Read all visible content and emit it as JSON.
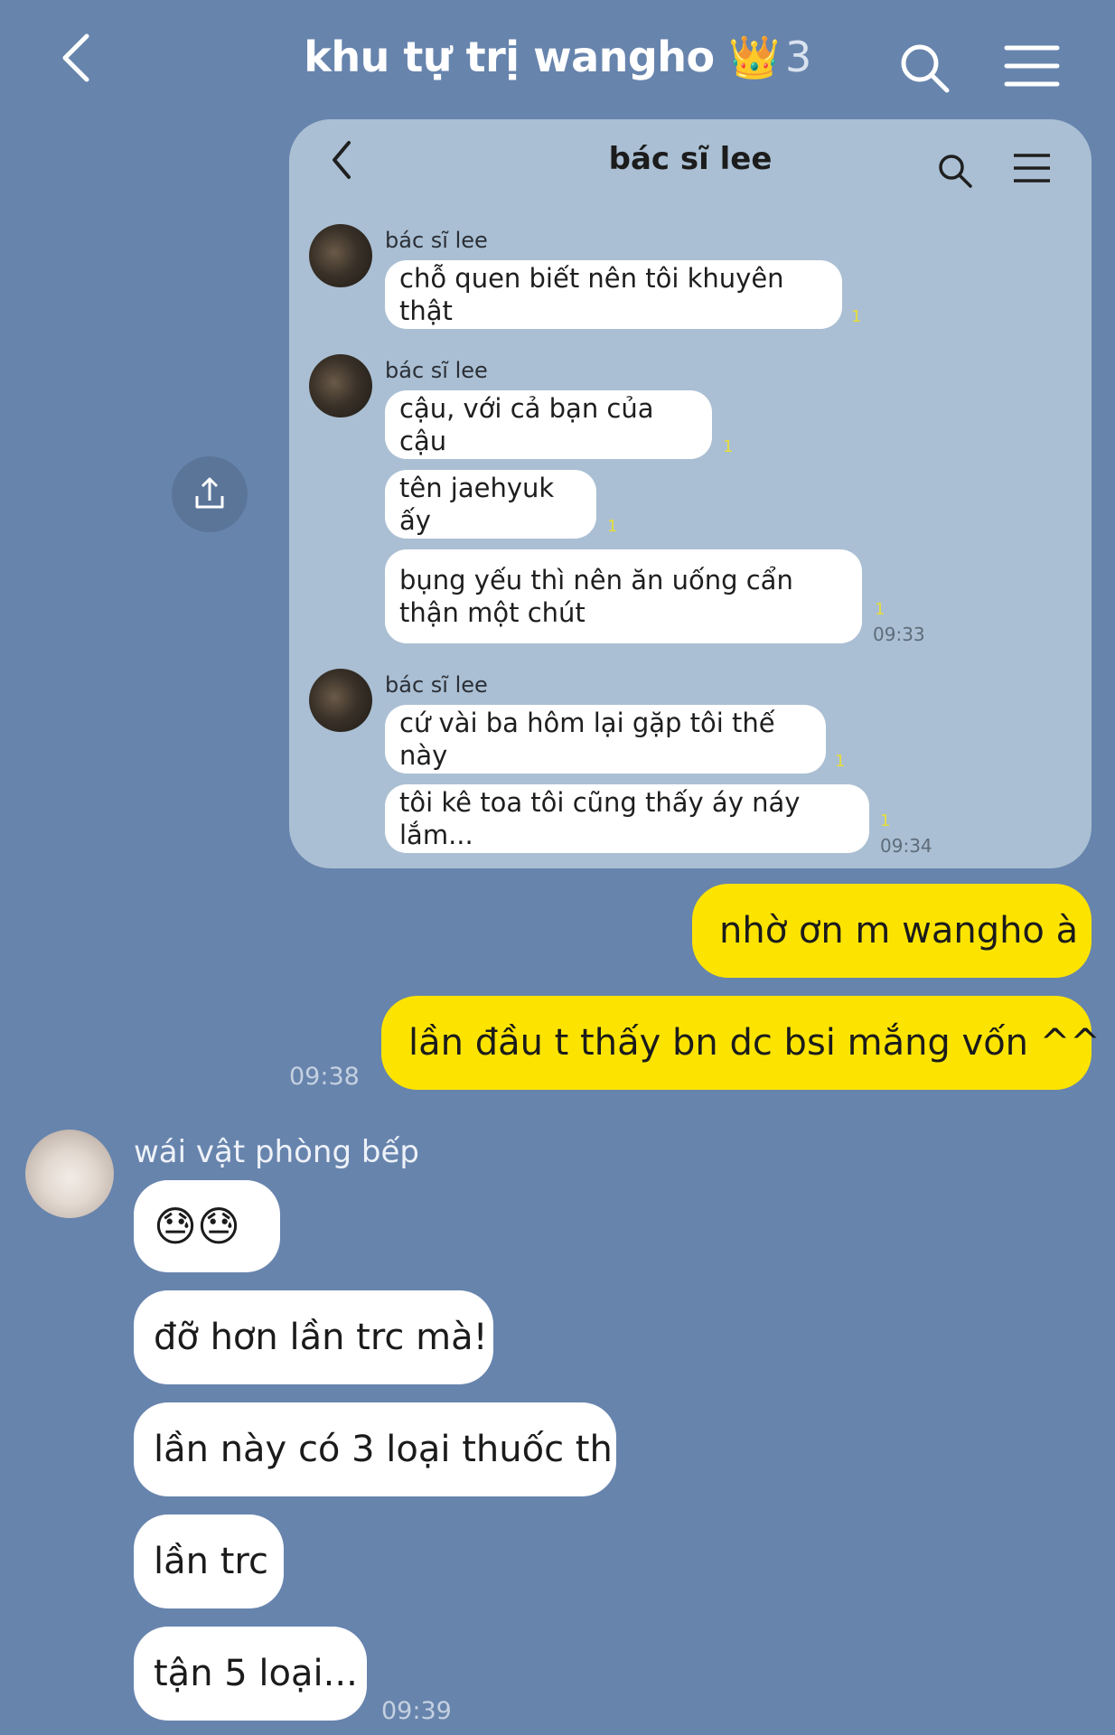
{
  "header": {
    "title": "khu tự trị wangho",
    "crown": "👑",
    "member_count": "3"
  },
  "attachment": {
    "title": "bác sĩ lee",
    "groups": [
      {
        "sender": "bác sĩ lee",
        "messages": [
          {
            "text": "chỗ quen biết nên tôi khuyên thật",
            "read": "1"
          }
        ]
      },
      {
        "sender": "bác sĩ lee",
        "messages": [
          {
            "text": "cậu, với cả bạn của cậu",
            "read": "1"
          },
          {
            "text": "tên jaehyuk ấy",
            "read": "1"
          },
          {
            "text": "bụng yếu thì nên ăn uống cẩn thận một chút",
            "read": "1",
            "time": "09:33"
          }
        ]
      },
      {
        "sender": "bác sĩ lee",
        "messages": [
          {
            "text": "cứ vài ba hôm lại gặp tôi thế này",
            "read": "1"
          },
          {
            "text": "tôi kê toa tôi cũng thấy áy náy lắm...",
            "read": "1",
            "time": "09:34"
          }
        ]
      }
    ]
  },
  "outgoing": [
    {
      "text": "nhờ ơn m wangho à"
    },
    {
      "text": "lần đầu t thấy bn dc bsi mắng vốn ^^",
      "time": "09:38"
    }
  ],
  "incoming": {
    "sender": "wái vật phòng bếp",
    "messages": [
      {
        "text": "😓😓"
      },
      {
        "text": "đỡ hơn lần trc mà!"
      },
      {
        "text": "lần này có 3 loại thuốc th"
      },
      {
        "text": "lần trc"
      },
      {
        "text": "tận 5 loại...",
        "time": "09:39"
      }
    ]
  },
  "colors": {
    "background": "#6784ad",
    "outgoing_bubble": "#fde400",
    "incoming_bubble": "#ffffff",
    "attachment_bg": "#aabfd3"
  },
  "icons": [
    "back-arrow-icon",
    "search-icon",
    "menu-icon",
    "share-icon"
  ]
}
